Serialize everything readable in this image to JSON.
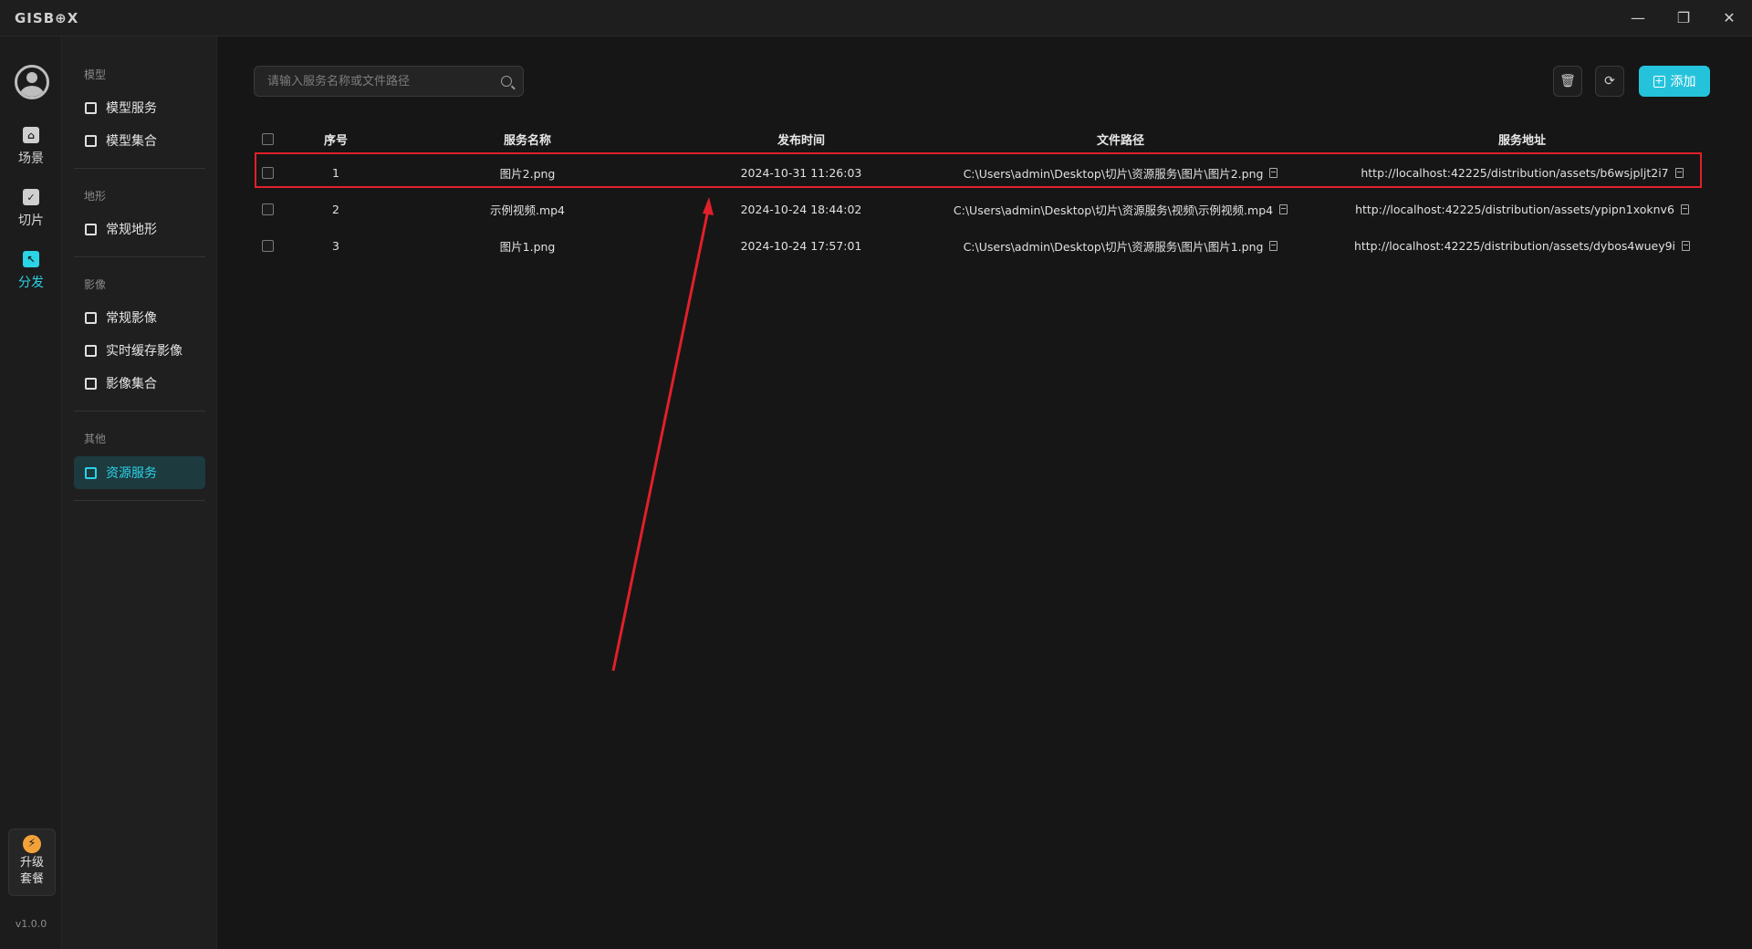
{
  "app": {
    "logo": "GISB⊕X",
    "version": "v1.0.0"
  },
  "window_controls": {
    "minimize": "—",
    "restore": "❐",
    "close": "✕"
  },
  "rail": {
    "items": [
      {
        "label": "场景",
        "icon": "scene-icon"
      },
      {
        "label": "切片",
        "icon": "slice-icon"
      },
      {
        "label": "分发",
        "icon": "distribute-icon",
        "active": true
      }
    ],
    "upgrade_line1": "升级",
    "upgrade_line2": "套餐"
  },
  "menu": {
    "groups": [
      {
        "title": "模型",
        "items": [
          "模型服务",
          "模型集合"
        ]
      },
      {
        "title": "地形",
        "items": [
          "常规地形"
        ]
      },
      {
        "title": "影像",
        "items": [
          "常规影像",
          "实时缓存影像",
          "影像集合"
        ]
      },
      {
        "title": "其他",
        "items": [
          "资源服务"
        ]
      }
    ],
    "active_item": "资源服务"
  },
  "toolbar": {
    "search_placeholder": "请输入服务名称或文件路径",
    "add_label": "添加"
  },
  "table": {
    "headers": [
      "序号",
      "服务名称",
      "发布时间",
      "文件路径",
      "服务地址"
    ],
    "rows": [
      {
        "index": "1",
        "name": "图片2.png",
        "time": "2024-10-31 11:26:03",
        "path": "C:\\Users\\admin\\Desktop\\切片\\资源服务\\图片\\图片2.png",
        "url": "http://localhost:42225/distribution/assets/b6wsjpljt2i7"
      },
      {
        "index": "2",
        "name": "示例视频.mp4",
        "time": "2024-10-24 18:44:02",
        "path": "C:\\Users\\admin\\Desktop\\切片\\资源服务\\视频\\示例视频.mp4",
        "url": "http://localhost:42225/distribution/assets/ypipn1xoknv6"
      },
      {
        "index": "3",
        "name": "图片1.png",
        "time": "2024-10-24 17:57:01",
        "path": "C:\\Users\\admin\\Desktop\\切片\\资源服务\\图片\\图片1.png",
        "url": "http://localhost:42225/distribution/assets/dybos4wuey9i"
      }
    ]
  },
  "colors": {
    "accent": "#2ad3e6",
    "add_button": "#25c3db",
    "annotation": "#e0202a",
    "upgrade_bolt": "#f3a23a"
  }
}
